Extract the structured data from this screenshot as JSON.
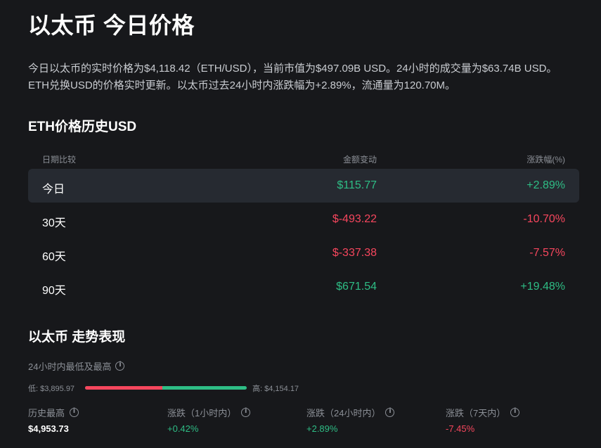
{
  "header": {
    "title": "以太币 今日价格"
  },
  "description": "今日以太币的实时价格为$4,118.42（ETH/USD），当前市值为$497.09B USD。24小时的成交量为$63.74B USD。ETH兑换USD的价格实时更新。以太币过去24小时内涨跌幅为+2.89%，流通量为120.70M。",
  "history": {
    "title": "ETH价格历史USD",
    "columns": [
      "日期比较",
      "金额变动",
      "涨跌幅(%)"
    ],
    "rows": [
      {
        "period": "今日",
        "amount": "$115.77",
        "change": "+2.89%",
        "trend": "up"
      },
      {
        "period": "30天",
        "amount": "$-493.22",
        "change": "-10.70%",
        "trend": "down"
      },
      {
        "period": "60天",
        "amount": "$-337.38",
        "change": "-7.57%",
        "trend": "down"
      },
      {
        "period": "90天",
        "amount": "$671.54",
        "change": "+19.48%",
        "trend": "up"
      }
    ]
  },
  "performance": {
    "title": "以太币 走势表现",
    "range_label": "24小时内最低及最高",
    "low_text": "低: $3,895.97",
    "high_text": "高: $4,154.17",
    "range_fill_fraction": 0.48,
    "stats": [
      {
        "label": "历史最高",
        "value": "$4,953.73",
        "tone": "neutral"
      },
      {
        "label": "涨跌（1小时内）",
        "value": "+0.42%",
        "tone": "up"
      },
      {
        "label": "涨跌（24小时内）",
        "value": "+2.89%",
        "tone": "up"
      },
      {
        "label": "涨跌（7天内）",
        "value": "-7.45%",
        "tone": "down"
      }
    ]
  },
  "colors": {
    "background": "#17181b",
    "positive": "#2ebd85",
    "negative": "#f6465d",
    "active_row": "#262a31"
  }
}
